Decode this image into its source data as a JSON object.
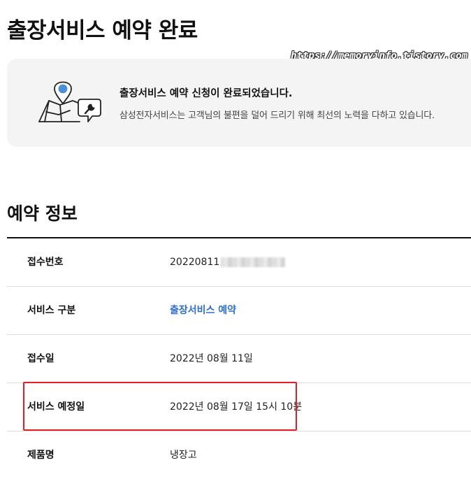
{
  "page": {
    "title": "출장서비스 예약 완료"
  },
  "watermark": {
    "text": "https://memoryinfo.tistory.com"
  },
  "notice": {
    "icon": "map-pin-wrench-icon",
    "title": "출장서비스 예약 신청이 완료되었습니다.",
    "description": "삼성전자서비스는 고객님의 불편을 덜어 드리기 위해 최선의 노력을 다하고 있습니다."
  },
  "reservation": {
    "section_title": "예약 정보",
    "rows": [
      {
        "label": "접수번호",
        "value": "20220811"
      },
      {
        "label": "서비스 구분",
        "value": "출장서비스 예약"
      },
      {
        "label": "접수일",
        "value": "2022년 08월 11일"
      },
      {
        "label": "서비스 예정일",
        "value": "2022년 08월 17일 15시 10분"
      },
      {
        "label": "제품명",
        "value": "냉장고"
      }
    ]
  },
  "colors": {
    "accent_link": "#2d6fd6",
    "highlight_border": "#e41e26",
    "notice_background": "#f4f4f4",
    "icon_pin": "#4a90d9"
  }
}
